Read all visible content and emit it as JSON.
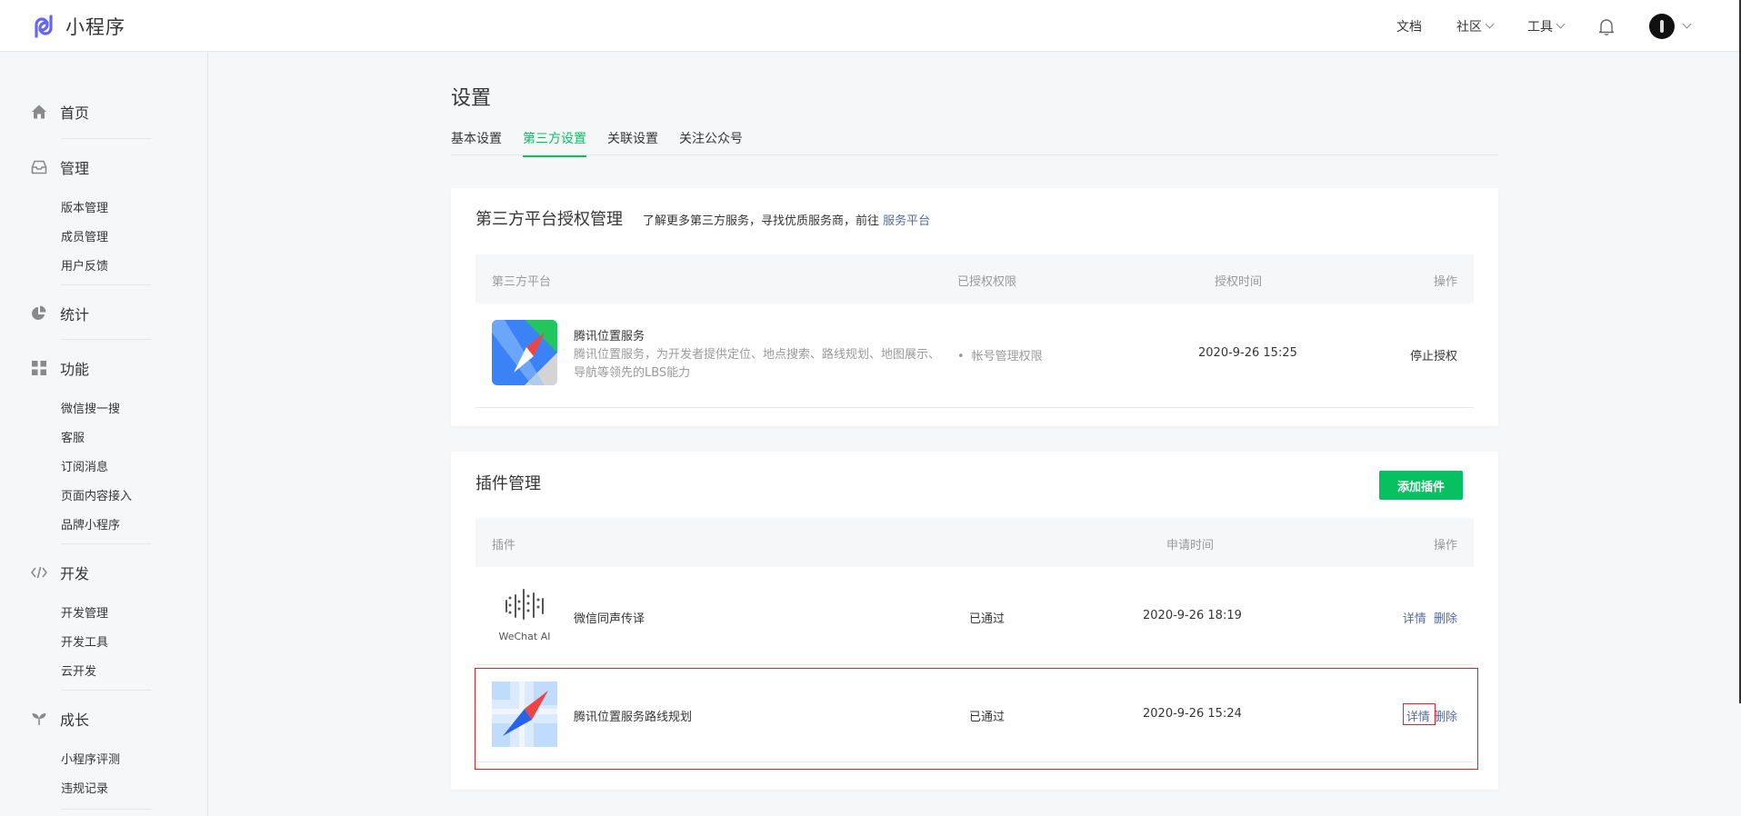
{
  "app": {
    "title": "小程序"
  },
  "topnav": {
    "docs": "文档",
    "community": "社区",
    "tools": "工具"
  },
  "sidebar": {
    "home": "首页",
    "manage": {
      "label": "管理",
      "items": [
        "版本管理",
        "成员管理",
        "用户反馈"
      ]
    },
    "stats": "统计",
    "features": {
      "label": "功能",
      "items": [
        "微信搜一搜",
        "客服",
        "订阅消息",
        "页面内容接入",
        "品牌小程序"
      ]
    },
    "dev": {
      "label": "开发",
      "items": [
        "开发管理",
        "开发工具",
        "云开发"
      ]
    },
    "growth": {
      "label": "成长",
      "items": [
        "小程序评测",
        "违规记录"
      ]
    }
  },
  "page": {
    "title": "设置",
    "tabs": [
      "基本设置",
      "第三方设置",
      "关联设置",
      "关注公众号"
    ],
    "active_tab": "第三方设置"
  },
  "third_party": {
    "title": "第三方平台授权管理",
    "desc": "了解更多第三方服务，寻找优质服务商，前往",
    "desc_link": "服务平台",
    "columns": [
      "第三方平台",
      "已授权权限",
      "授权时间",
      "操作"
    ],
    "rows": [
      {
        "name": "腾讯位置服务",
        "description": "腾讯位置服务，为开发者提供定位、地点搜索、路线规划、地图展示、导航等领先的LBS能力",
        "permission": "帐号管理权限",
        "time": "2020-9-26 15:25",
        "action": "停止授权"
      }
    ]
  },
  "plugins": {
    "title": "插件管理",
    "add_button": "添加插件",
    "columns": [
      "插件",
      "申请时间",
      "操作"
    ],
    "rows": [
      {
        "name": "微信同声传译",
        "icon_caption": "WeChat AI",
        "status": "已通过",
        "time": "2020-9-26 18:19",
        "detail": "详情",
        "delete": "删除"
      },
      {
        "name": "腾讯位置服务路线规划",
        "status": "已通过",
        "time": "2020-9-26 15:24",
        "detail": "详情",
        "delete": "删除"
      }
    ]
  },
  "colors": {
    "accent": "#07c160",
    "link": "#576b95",
    "highlight": "#e5212b"
  },
  "icons": [
    "miniprogram-logo-icon",
    "bell-icon",
    "home-icon",
    "inbox-icon",
    "pie-chart-icon",
    "grid-icon",
    "code-icon",
    "sprout-icon",
    "chevron-down-icon"
  ]
}
